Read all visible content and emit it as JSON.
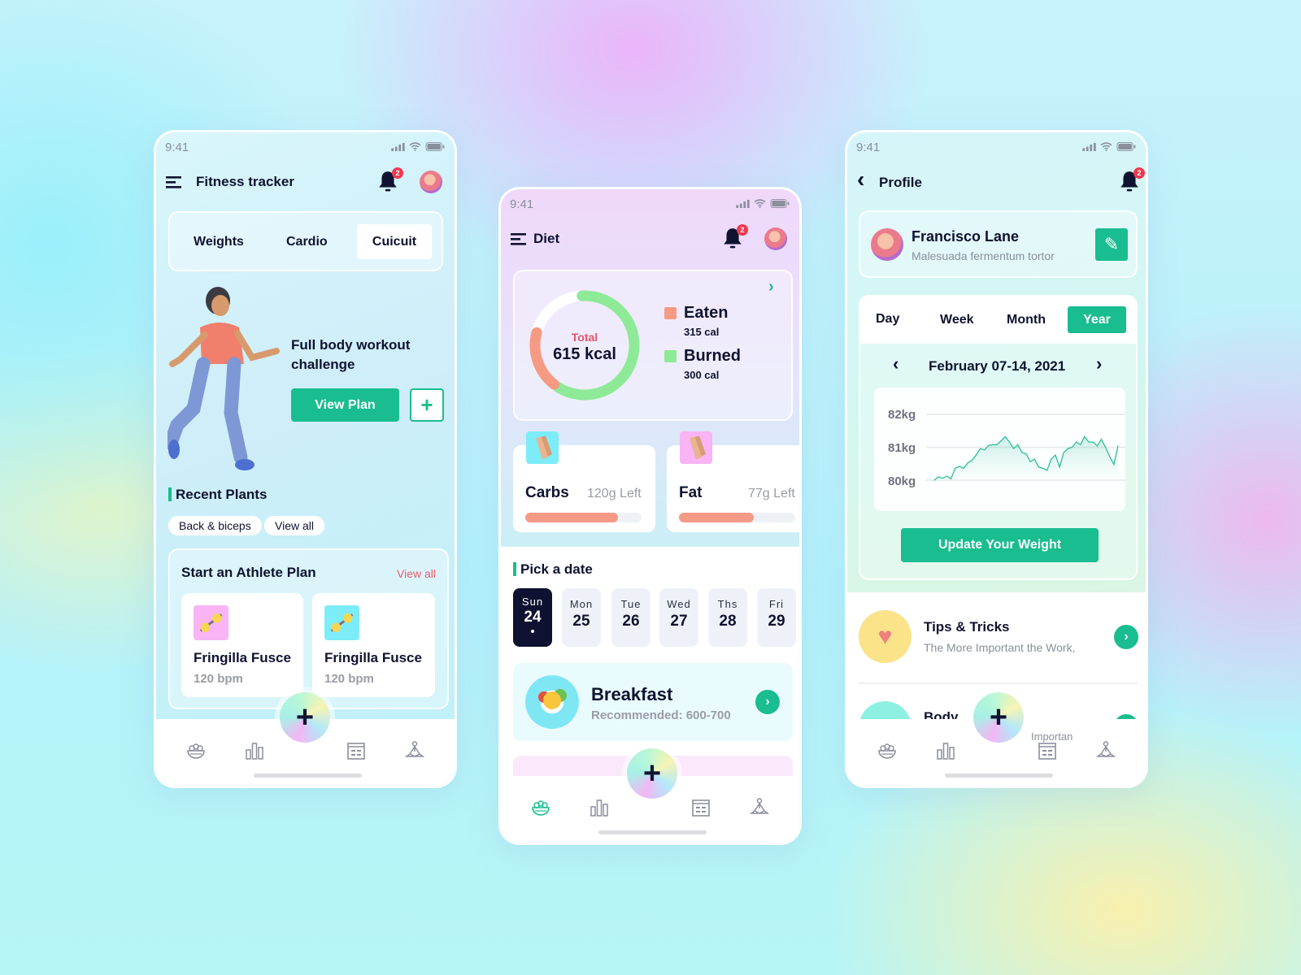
{
  "status_time": "9:41",
  "notification_count": "2",
  "accent_color": "#19bd8f",
  "fitness": {
    "title": "Fitness tracker",
    "tabs": [
      {
        "label": "Weights"
      },
      {
        "label": "Cardio"
      },
      {
        "label": "Cuicuit",
        "selected": true
      }
    ],
    "hero": {
      "title": "Full body workout challenge",
      "view_plan": "View Plan",
      "add": "+"
    },
    "recent": {
      "title": "Recent Plants",
      "chips": [
        "Back & biceps",
        "View all"
      ]
    },
    "athlete": {
      "title": "Start an Athlete Plan",
      "view_all": "View all",
      "cards": [
        {
          "name": "Fringilla Fusce",
          "sub": "120 bpm",
          "icon": "dumbbell-icon",
          "color": "#f8b4f4"
        },
        {
          "name": "Fringilla Fusce",
          "sub": "120 bpm",
          "icon": "dumbbell-icon",
          "color": "#7cecf8"
        }
      ]
    }
  },
  "diet": {
    "title": "Diet",
    "calories": {
      "total_label": "Total",
      "total_value": "615 kcal",
      "eaten": {
        "label": "Eaten",
        "value": "315 cal",
        "color": "#f79a84"
      },
      "burned": {
        "label": "Burned",
        "value": "300 cal",
        "color": "#8eea97"
      }
    },
    "macros": [
      {
        "name": "Carbs",
        "left": "120g Left",
        "progress": 0.8,
        "color": "#7cecf8"
      },
      {
        "name": "Fat",
        "left": "77g Left",
        "progress": 0.64,
        "color": "#f8b4f4"
      }
    ],
    "pick_date": "Pick a date",
    "days": [
      {
        "d": "Sun",
        "n": "24",
        "selected": true
      },
      {
        "d": "Mon",
        "n": "25"
      },
      {
        "d": "Tue",
        "n": "26"
      },
      {
        "d": "Wed",
        "n": "27"
      },
      {
        "d": "Ths",
        "n": "28"
      },
      {
        "d": "Fri",
        "n": "29"
      }
    ],
    "meal": {
      "title": "Breakfast",
      "sub": "Recommended: 600-700"
    }
  },
  "profile": {
    "title": "Profile",
    "user": {
      "name": "Francisco Lane",
      "sub": "Malesuada fermentum tortor"
    },
    "periods": [
      {
        "label": "Day"
      },
      {
        "label": "Week"
      },
      {
        "label": "Month"
      },
      {
        "label": "Year",
        "selected": true
      }
    ],
    "date_range": "February 07-14, 2021",
    "update_button": "Update Your Weight",
    "tips": [
      {
        "title": "Tips & Tricks",
        "sub": "The More Important the Work,"
      },
      {
        "title": "Body",
        "sub": "Importan"
      }
    ]
  },
  "chart_data": {
    "type": "area",
    "yticks": [
      "82kg",
      "81kg",
      "80kg"
    ],
    "ylim": [
      80,
      82
    ],
    "grid": true,
    "color": "#2dbf98",
    "values": [
      80.0,
      80.1,
      80.06,
      80.12,
      80.04,
      80.36,
      80.42,
      80.36,
      80.52,
      80.6,
      80.76,
      80.96,
      80.92,
      81.06,
      81.08,
      81.08,
      81.2,
      81.32,
      81.16,
      80.96,
      81.08,
      80.84,
      80.8,
      80.56,
      80.64,
      80.4,
      80.36,
      80.3,
      80.64,
      80.76,
      80.4,
      80.84,
      80.96,
      81.0,
      81.16,
      81.08,
      81.32,
      81.16,
      81.16,
      81.04,
      81.24,
      81.0,
      80.72,
      80.48,
      81.04
    ]
  }
}
